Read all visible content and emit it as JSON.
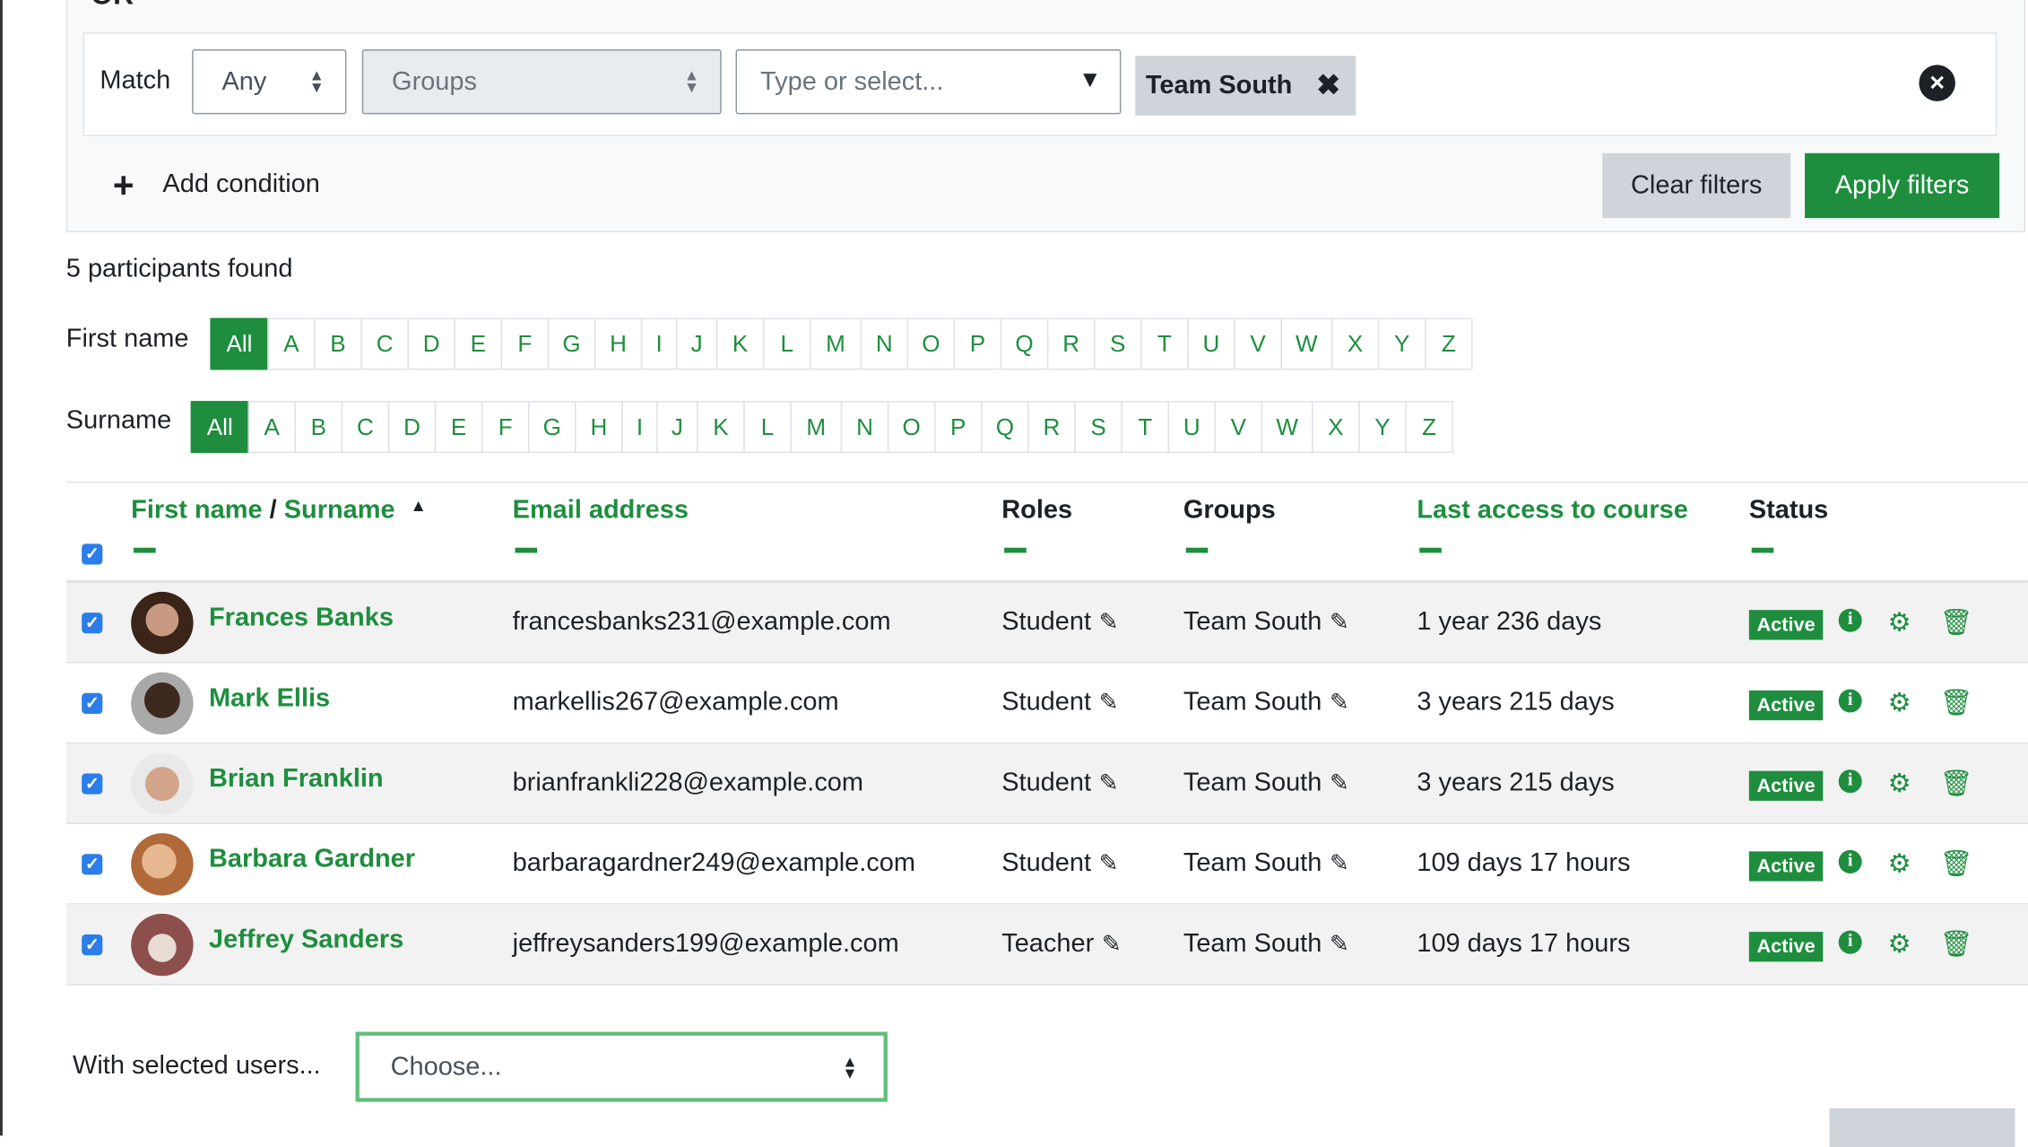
{
  "filter": {
    "heading": "OR",
    "match_label": "Match",
    "match_value": "Any",
    "field_value": "Groups",
    "type_placeholder": "Type or select...",
    "chip_label": "Team South",
    "add_condition": "Add condition",
    "clear_filters": "Clear filters",
    "apply_filters": "Apply filters"
  },
  "found_text": "5 participants found",
  "firstname_label": "First name",
  "surname_label": "Surname",
  "letters": [
    "All",
    "A",
    "B",
    "C",
    "D",
    "E",
    "F",
    "G",
    "H",
    "I",
    "J",
    "K",
    "L",
    "M",
    "N",
    "O",
    "P",
    "Q",
    "R",
    "S",
    "T",
    "U",
    "V",
    "W",
    "X",
    "Y",
    "Z"
  ],
  "table": {
    "col_first": "First name",
    "col_sep": "/",
    "col_surname": "Surname",
    "col_email": "Email address",
    "col_roles": "Roles",
    "col_groups": "Groups",
    "col_access": "Last access to course",
    "col_status": "Status",
    "rows": [
      {
        "name": "Frances Banks",
        "email": "francesbanks231@example.com",
        "role": "Student",
        "group": "Team South",
        "access": "1 year 236 days",
        "status": "Active"
      },
      {
        "name": "Mark Ellis",
        "email": "markellis267@example.com",
        "role": "Student",
        "group": "Team South",
        "access": "3 years 215 days",
        "status": "Active"
      },
      {
        "name": "Brian Franklin",
        "email": "brianfrankli228@example.com",
        "role": "Student",
        "group": "Team South",
        "access": "3 years 215 days",
        "status": "Active"
      },
      {
        "name": "Barbara Gardner",
        "email": "barbaragardner249@example.com",
        "role": "Student",
        "group": "Team South",
        "access": "109 days 17 hours",
        "status": "Active"
      },
      {
        "name": "Jeffrey Sanders",
        "email": "jeffreysanders199@example.com",
        "role": "Teacher",
        "group": "Team South",
        "access": "109 days 17 hours",
        "status": "Active"
      }
    ]
  },
  "bulk": {
    "label": "With selected users...",
    "choose": "Choose..."
  },
  "colors": {
    "accent": "#1e8e3e",
    "checkbox": "#2b7de9"
  }
}
